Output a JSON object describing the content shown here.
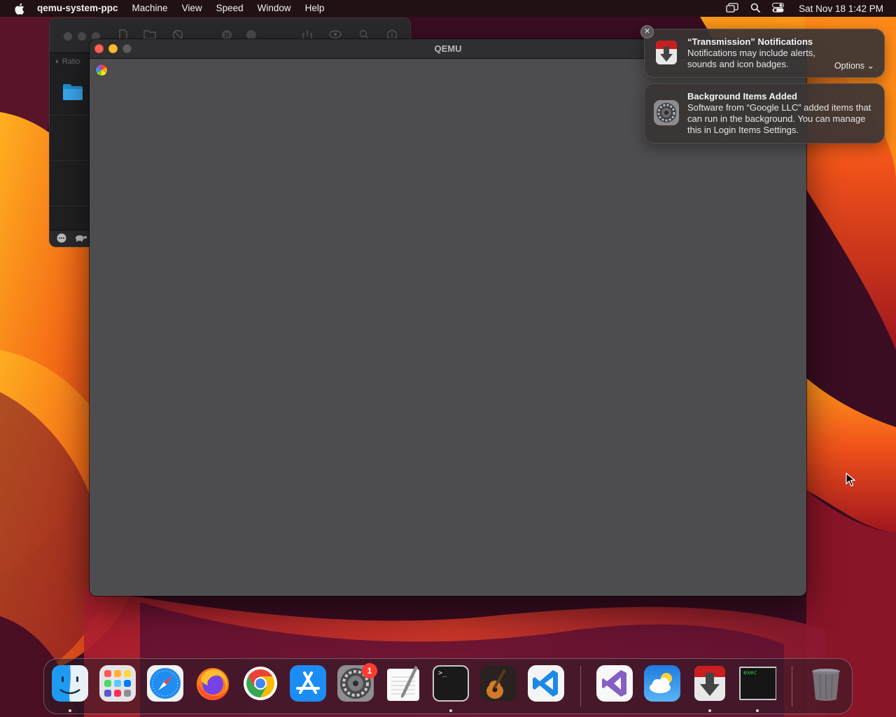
{
  "menubar": {
    "app_name": "qemu-system-ppc",
    "menus": [
      "Machine",
      "View",
      "Speed",
      "Window",
      "Help"
    ],
    "clock": "Sat Nov 18  1:42 PM",
    "status_icons": [
      "screen-mirroring-icon",
      "spotlight-search-icon",
      "control-center-icon"
    ]
  },
  "background_window": {
    "sidebar_label": "Ratio"
  },
  "qemu_window": {
    "title": "QEMU"
  },
  "notifications": [
    {
      "app_icon": "transmission-icon",
      "title": "“Transmission” Notifications",
      "body": "Notifications may include alerts, sounds and icon badges.",
      "options_label": "Options"
    },
    {
      "app_icon": "system-settings-icon",
      "title": "Background Items Added",
      "body": "Software from “Google LLC” added items that can run in the background. You can manage this in Login Items Settings."
    }
  ],
  "dock": {
    "apps": [
      "Finder",
      "Launchpad",
      "Safari",
      "Firefox",
      "Google Chrome",
      "App Store",
      "System Settings",
      "TextEdit",
      "Terminal",
      "GarageBand",
      "Visual Studio Code",
      "Visual Studio",
      "Weather",
      "Transmission",
      "exec",
      "Trash"
    ],
    "settings_badge": "1",
    "terminal_prompt": ">_",
    "exec_label": "exec"
  },
  "colors": {
    "close": "#ff5f57",
    "minimize": "#febc2e",
    "badge": "#ff3b30",
    "qemu_screen": "#4d4d4f"
  }
}
